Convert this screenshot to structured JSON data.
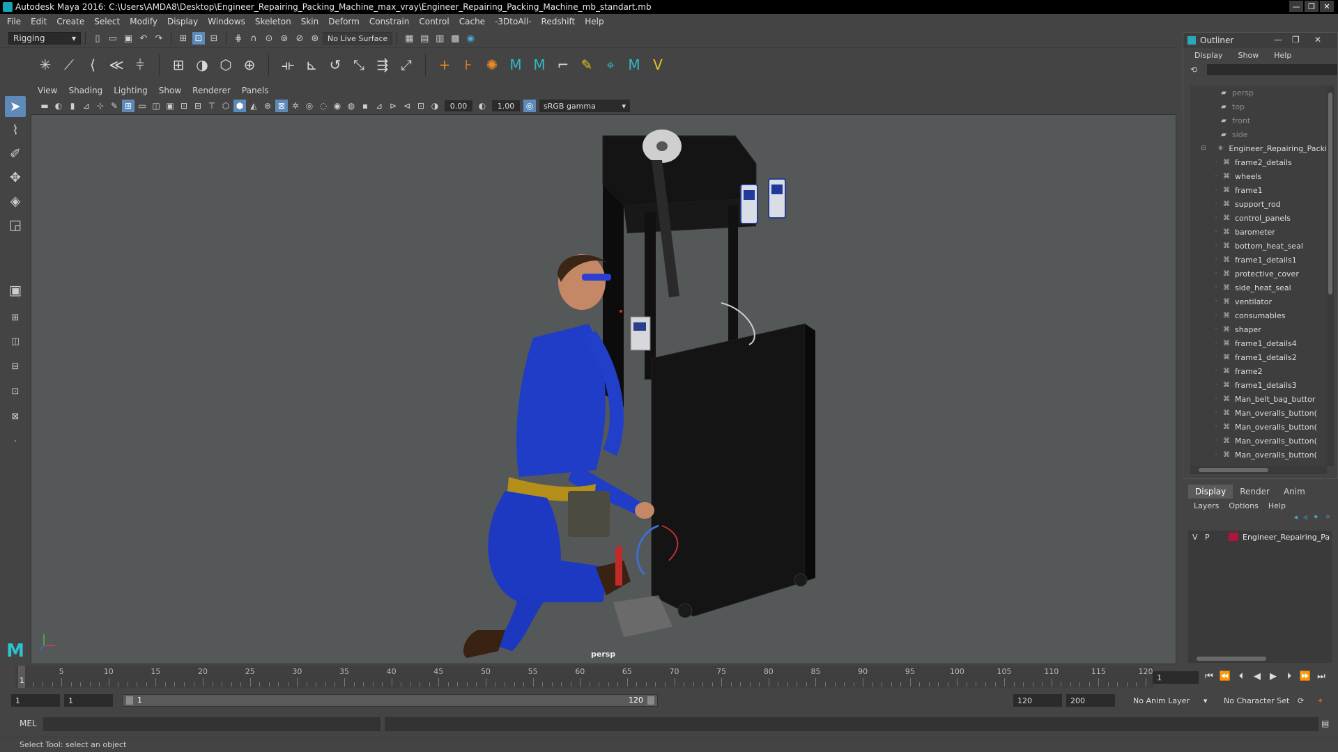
{
  "window": {
    "title": "Autodesk Maya 2016: C:\\Users\\AMDA8\\Desktop\\Engineer_Repairing_Packing_Machine_max_vray\\Engineer_Repairing_Packing_Machine_mb_standart.mb",
    "controls": [
      "minimize-icon",
      "restore-icon",
      "close-icon"
    ]
  },
  "menubar": [
    "File",
    "Edit",
    "Create",
    "Select",
    "Modify",
    "Display",
    "Windows",
    "Skeleton",
    "Skin",
    "Deform",
    "Constrain",
    "Control",
    "Cache",
    "-3DtoAll-",
    "Redshift",
    "Help"
  ],
  "statusline": {
    "mode": "Rigging",
    "live_surface": "No Live Surface"
  },
  "viewport": {
    "menu": [
      "View",
      "Shading",
      "Lighting",
      "Show",
      "Renderer",
      "Panels"
    ],
    "exposure": "0.00",
    "gamma": "1.00",
    "color_space": "sRGB gamma",
    "camera_label": "persp"
  },
  "outliner": {
    "title": "Outliner",
    "menu": [
      "Display",
      "Show",
      "Help"
    ],
    "cameras": [
      "persp",
      "top",
      "front",
      "side"
    ],
    "root": "Engineer_Repairing_Packi",
    "children": [
      "frame2_details",
      "wheels",
      "frame1",
      "support_rod",
      "control_panels",
      "barometer",
      "bottom_heat_seal",
      "frame1_details1",
      "protective_cover",
      "side_heat_seal",
      "ventilator",
      "consumables",
      "shaper",
      "frame1_details4",
      "frame1_details2",
      "frame2",
      "frame1_details3",
      "Man_belt_bag_buttor",
      "Man_overalls_button(",
      "Man_overalls_button(",
      "Man_overalls_button(",
      "Man_overalls_button("
    ]
  },
  "layer_editor": {
    "tabs": [
      "Display",
      "Render",
      "Anim"
    ],
    "active_tab": "Display",
    "menu": [
      "Layers",
      "Options",
      "Help"
    ],
    "layers": [
      {
        "v": "V",
        "p": "P",
        "name": "Engineer_Repairing_Pa",
        "color": "#b0143c"
      }
    ]
  },
  "timeline": {
    "ticks": [
      "5",
      "10",
      "15",
      "20",
      "25",
      "30",
      "35",
      "40",
      "45",
      "50",
      "55",
      "60",
      "65",
      "70",
      "75",
      "80",
      "85",
      "90",
      "95",
      "100",
      "105",
      "110",
      "115",
      "120"
    ],
    "current_frame": "1",
    "current_frame_field": "1"
  },
  "range": {
    "start": "1",
    "playback_start": "1",
    "bar_start": "1",
    "bar_end": "120",
    "playback_end": "120",
    "end": "200",
    "anim_layer": "No Anim Layer",
    "character_set": "No Character Set"
  },
  "command": {
    "mel_label": "MEL",
    "help_text": "Select Tool: select an object"
  }
}
